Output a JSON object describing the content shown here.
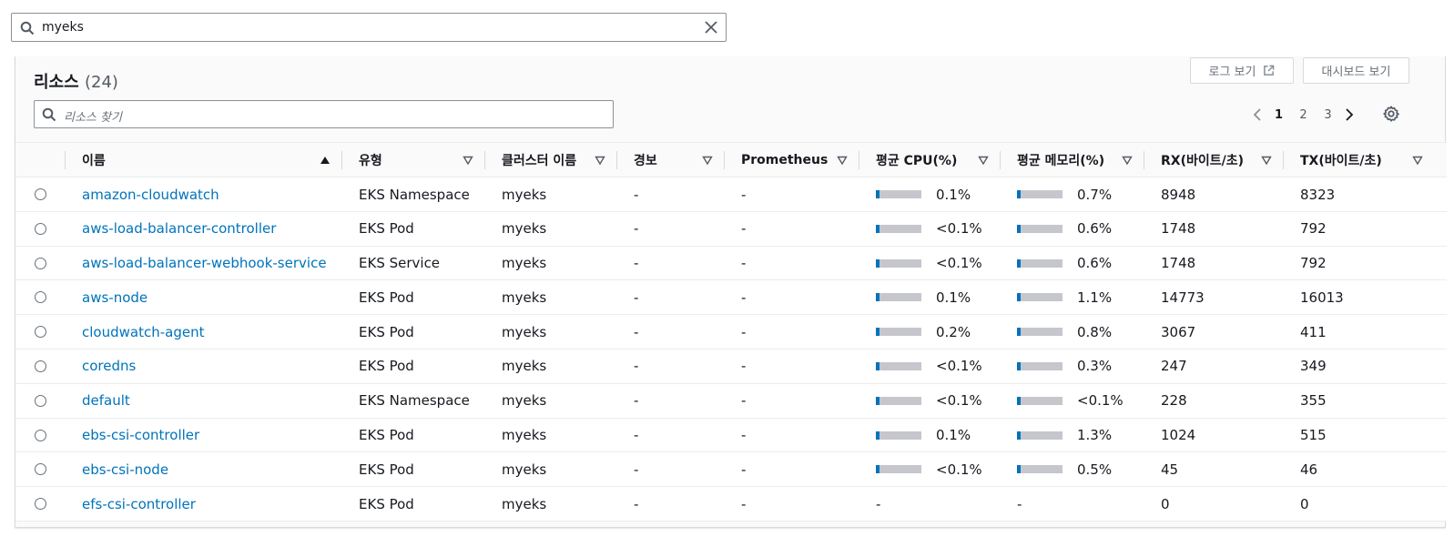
{
  "search": {
    "value": "myeks"
  },
  "panel": {
    "title": "리소스",
    "count": "(24)",
    "log_button": "로그 보기",
    "dashboard_button": "대시보드 보기",
    "filter_placeholder": "리소스 찾기",
    "pagination": {
      "pages": [
        "1",
        "2",
        "3"
      ],
      "current": "1"
    }
  },
  "columns": [
    {
      "label": "이름",
      "sort": "asc"
    },
    {
      "label": "유형",
      "sort": "none"
    },
    {
      "label": "클러스터 이름",
      "sort": "none"
    },
    {
      "label": "경보",
      "sort": "none"
    },
    {
      "label": "Prometheus",
      "sort": "none"
    },
    {
      "label": "평균 CPU(%)",
      "sort": "none"
    },
    {
      "label": "평균 메모리(%)",
      "sort": "none"
    },
    {
      "label": "RX(바이트/초)",
      "sort": "none"
    },
    {
      "label": "TX(바이트/초)",
      "sort": "none"
    }
  ],
  "rows": [
    {
      "name": "amazon-cloudwatch",
      "type": "EKS Namespace",
      "cluster": "myeks",
      "alarm": "-",
      "prometheus": "-",
      "cpu": "0.1%",
      "cpu_fraction": 0.01,
      "mem": "0.7%",
      "mem_fraction": 0.01,
      "rx": "8948",
      "tx": "8323"
    },
    {
      "name": "aws-load-balancer-controller",
      "type": "EKS Pod",
      "cluster": "myeks",
      "alarm": "-",
      "prometheus": "-",
      "cpu": "<0.1%",
      "cpu_fraction": 0.01,
      "mem": "0.6%",
      "mem_fraction": 0.01,
      "rx": "1748",
      "tx": "792"
    },
    {
      "name": "aws-load-balancer-webhook-service",
      "type": "EKS Service",
      "cluster": "myeks",
      "alarm": "-",
      "prometheus": "-",
      "cpu": "<0.1%",
      "cpu_fraction": 0.01,
      "mem": "0.6%",
      "mem_fraction": 0.01,
      "rx": "1748",
      "tx": "792"
    },
    {
      "name": "aws-node",
      "type": "EKS Pod",
      "cluster": "myeks",
      "alarm": "-",
      "prometheus": "-",
      "cpu": "0.1%",
      "cpu_fraction": 0.01,
      "mem": "1.1%",
      "mem_fraction": 0.011,
      "rx": "14773",
      "tx": "16013"
    },
    {
      "name": "cloudwatch-agent",
      "type": "EKS Pod",
      "cluster": "myeks",
      "alarm": "-",
      "prometheus": "-",
      "cpu": "0.2%",
      "cpu_fraction": 0.01,
      "mem": "0.8%",
      "mem_fraction": 0.01,
      "rx": "3067",
      "tx": "411"
    },
    {
      "name": "coredns",
      "type": "EKS Pod",
      "cluster": "myeks",
      "alarm": "-",
      "prometheus": "-",
      "cpu": "<0.1%",
      "cpu_fraction": 0.01,
      "mem": "0.3%",
      "mem_fraction": 0.01,
      "rx": "247",
      "tx": "349"
    },
    {
      "name": "default",
      "type": "EKS Namespace",
      "cluster": "myeks",
      "alarm": "-",
      "prometheus": "-",
      "cpu": "<0.1%",
      "cpu_fraction": 0.01,
      "mem": "<0.1%",
      "mem_fraction": 0.01,
      "rx": "228",
      "tx": "355"
    },
    {
      "name": "ebs-csi-controller",
      "type": "EKS Pod",
      "cluster": "myeks",
      "alarm": "-",
      "prometheus": "-",
      "cpu": "0.1%",
      "cpu_fraction": 0.01,
      "mem": "1.3%",
      "mem_fraction": 0.013,
      "rx": "1024",
      "tx": "515"
    },
    {
      "name": "ebs-csi-node",
      "type": "EKS Pod",
      "cluster": "myeks",
      "alarm": "-",
      "prometheus": "-",
      "cpu": "<0.1%",
      "cpu_fraction": 0.01,
      "mem": "0.5%",
      "mem_fraction": 0.01,
      "rx": "45",
      "tx": "46"
    },
    {
      "name": "efs-csi-controller",
      "type": "EKS Pod",
      "cluster": "myeks",
      "alarm": "-",
      "prometheus": "-",
      "cpu": "-",
      "cpu_fraction": null,
      "mem": "-",
      "mem_fraction": null,
      "rx": "0",
      "tx": "0"
    }
  ],
  "colors": {
    "link": "#0073bb",
    "bar_bg": "#c6c6cd",
    "bar_fill": "#0073bb"
  },
  "icons": {
    "search": "search-icon",
    "clear": "close-icon",
    "external": "external-link-icon",
    "prev": "chevron-left-icon",
    "next": "chevron-right-icon",
    "settings": "gear-icon",
    "sort_asc": "sort-ascending-icon",
    "sort_none": "sort-unsorted-icon"
  }
}
